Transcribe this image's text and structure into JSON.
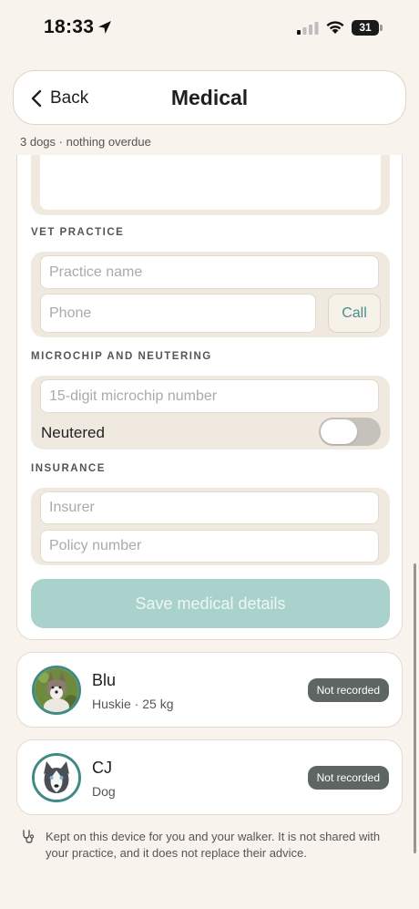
{
  "status_bar": {
    "time": "18:33",
    "battery": "31"
  },
  "header": {
    "back_label": "Back",
    "title": "Medical"
  },
  "summary": "3 dogs · nothing overdue",
  "form": {
    "vet_practice": {
      "label": "VET PRACTICE",
      "practice_placeholder": "Practice name",
      "phone_placeholder": "Phone",
      "call_label": "Call"
    },
    "microchip": {
      "label": "MICROCHIP AND NEUTERING",
      "chip_placeholder": "15-digit microchip number",
      "neutered_label": "Neutered",
      "neutered": false
    },
    "insurance": {
      "label": "INSURANCE",
      "insurer_placeholder": "Insurer",
      "policy_placeholder": "Policy number"
    },
    "save_label": "Save medical details"
  },
  "dogs": [
    {
      "name": "Blu",
      "detail": "Huskie · 25 kg",
      "status": "Not recorded"
    },
    {
      "name": "CJ",
      "detail": "Dog",
      "status": "Not recorded"
    }
  ],
  "footnote": "Kept on this device for you and your walker. It is not shared with your practice, and it does not replace their advice.",
  "colors": {
    "accent": "#3f8a83",
    "save_button": "#a9d2cc",
    "badge": "#5d6662",
    "background": "#f8f3ec"
  }
}
